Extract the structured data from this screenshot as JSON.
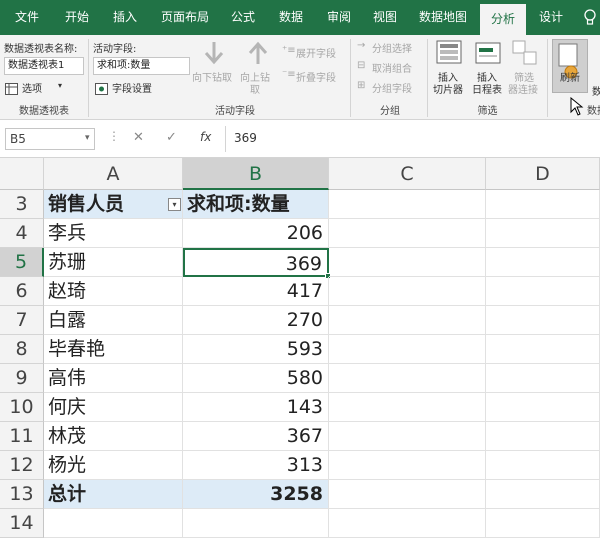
{
  "tabs": [
    "文件",
    "开始",
    "插入",
    "页面布局",
    "公式",
    "数据",
    "审阅",
    "视图",
    "数据地图",
    "分析",
    "设计"
  ],
  "ribbon": {
    "pt_name_label": "数据透视表名称:",
    "pt_name_value": "数据透视表1",
    "options_label": "选项",
    "group_pivot": "数据透视表",
    "active_field_label": "活动字段:",
    "active_field_value": "求和项:数量",
    "field_settings": "字段设置",
    "drill_down_1": "向下钻取",
    "drill_up_1": "向上钻",
    "drill_up_2": "取",
    "expand_field": "展开字段",
    "collapse_field": "折叠字段",
    "group_active": "活动字段",
    "group_selection": "分组选择",
    "ungroup": "取消组合",
    "group_field": "分组字段",
    "group_group": "分组",
    "insert_slicer_1": "插入",
    "insert_slicer_2": "切片器",
    "insert_timeline_1": "插入",
    "insert_timeline_2": "日程表",
    "filter_conn_1": "筛选",
    "filter_conn_2": "器连接",
    "group_filter": "筛选",
    "refresh": "刷新",
    "data_partial": "数",
    "data_group_partial": "数据"
  },
  "formula_bar": {
    "name_box": "B5",
    "fx": "fx",
    "value": "369"
  },
  "columns": [
    "A",
    "B",
    "C",
    "D"
  ],
  "rows": [
    {
      "num": "3",
      "a": "销售人员",
      "b": "求和项:数量",
      "type": "header"
    },
    {
      "num": "4",
      "a": "李兵",
      "b": "206",
      "type": "data"
    },
    {
      "num": "5",
      "a": "苏珊",
      "b": "369",
      "type": "data"
    },
    {
      "num": "6",
      "a": "赵琦",
      "b": "417",
      "type": "data"
    },
    {
      "num": "7",
      "a": "白露",
      "b": "270",
      "type": "data"
    },
    {
      "num": "8",
      "a": "毕春艳",
      "b": "593",
      "type": "data"
    },
    {
      "num": "9",
      "a": "高伟",
      "b": "580",
      "type": "data"
    },
    {
      "num": "10",
      "a": "何庆",
      "b": "143",
      "type": "data"
    },
    {
      "num": "11",
      "a": "林茂",
      "b": "367",
      "type": "data"
    },
    {
      "num": "12",
      "a": "杨光",
      "b": "313",
      "type": "data"
    },
    {
      "num": "13",
      "a": "总计",
      "b": "3258",
      "type": "total"
    },
    {
      "num": "14",
      "a": "",
      "b": "",
      "type": "empty"
    }
  ],
  "colors": {
    "excel_green": "#217346",
    "pivot_blue": "#ddebf7"
  }
}
